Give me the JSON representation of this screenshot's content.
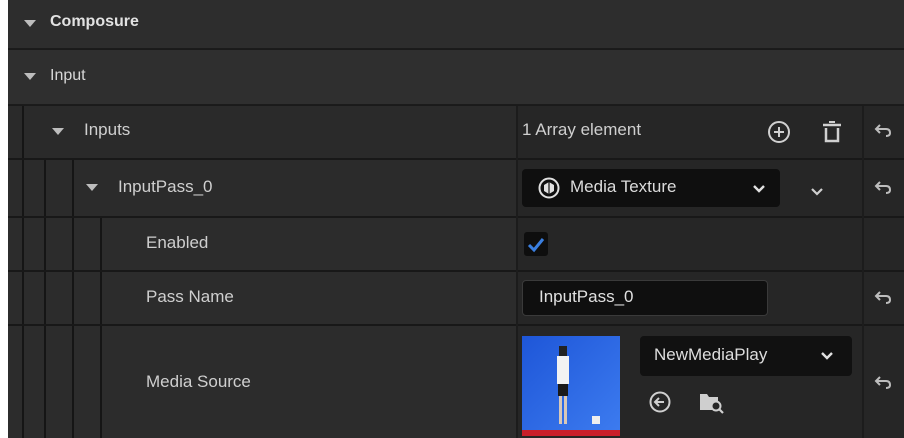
{
  "categories": {
    "composure": "Composure",
    "input": "Input"
  },
  "inputs_row": {
    "label": "Inputs",
    "value": "1 Array element"
  },
  "input_pass_row": {
    "label": "InputPass_0",
    "type_combo": "Media Texture"
  },
  "enabled_row": {
    "label": "Enabled",
    "checked": true
  },
  "pass_name_row": {
    "label": "Pass Name",
    "value": "InputPass_0"
  },
  "media_source_row": {
    "label": "Media Source",
    "asset_name": "NewMediaPlay"
  },
  "colors": {
    "accent": "#3a7fe0",
    "thumbnail_bar": "#c81f2a"
  },
  "icons": {
    "expand": "triangle-down-icon",
    "add": "plus-circle-icon",
    "delete": "trash-icon",
    "reset": "reset-arrow-icon",
    "texture": "media-texture-icon",
    "use_selected": "arrow-left-circle-icon",
    "browse": "folder-search-icon"
  }
}
